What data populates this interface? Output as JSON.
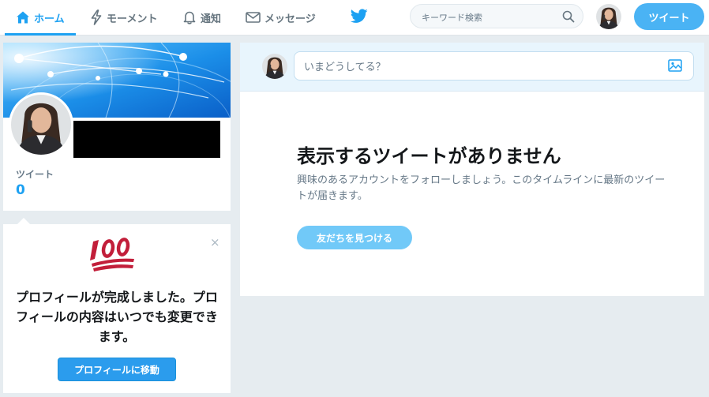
{
  "nav": {
    "items": [
      {
        "label": "ホーム",
        "icon": "home-icon",
        "active": true
      },
      {
        "label": "モーメント",
        "icon": "lightning-icon",
        "active": false
      },
      {
        "label": "通知",
        "icon": "bell-icon",
        "active": false
      },
      {
        "label": "メッセージ",
        "icon": "envelope-icon",
        "active": false
      }
    ],
    "logo_icon": "twitter-bird-icon",
    "search_placeholder": "キーワード検索",
    "tweet_button": "ツイート"
  },
  "profile": {
    "stat_label": "ツイート",
    "stat_value": "0"
  },
  "completion": {
    "emoji": "100",
    "message": "プロフィールが完成しました。プロフィールの内容はいつでも変更できます。",
    "button": "プロフィールに移動",
    "close": "×"
  },
  "timeline": {
    "composer_placeholder": "いまどうしてる？",
    "empty_title": "表示するツイートがありません",
    "empty_description": "興味のあるアカウントをフォローしましょう。このタイムラインに最新のツイートが届きます。",
    "find_button": "友だちを見つける"
  },
  "colors": {
    "accent": "#1da1f2",
    "button": "#4ab3f4",
    "background": "#e6ecf0"
  }
}
